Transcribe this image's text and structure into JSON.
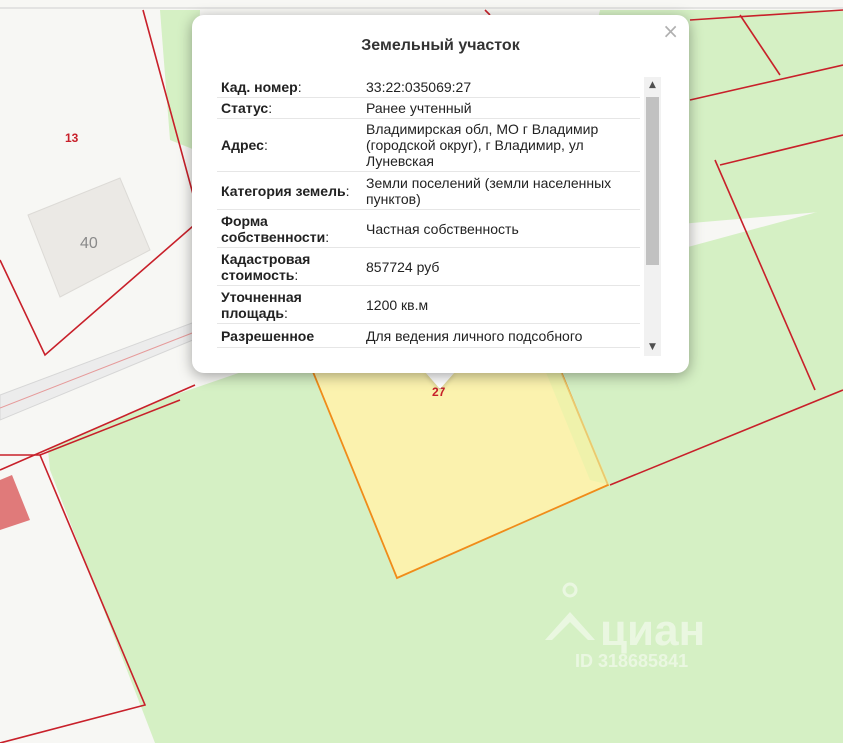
{
  "map": {
    "labels": {
      "parcel_13": "13",
      "building_40": "40",
      "parcel_27": "27"
    },
    "watermark": {
      "brand": "циан",
      "id_text": "ID 318685841"
    },
    "colors": {
      "land_green": "#d5f0c4",
      "boundary_red": "#c8202a",
      "selected_fill": "#fbf2ae",
      "selected_border": "#f08c19"
    }
  },
  "popup": {
    "title": "Земельный участок",
    "close_symbol": "×",
    "rows": [
      {
        "label": "Кад. номер",
        "colon": ":",
        "value": "33:22:035069:27"
      },
      {
        "label": "Статус",
        "colon": ":",
        "value": "Ранее учтенный"
      },
      {
        "label": "Адрес",
        "colon": ":",
        "value": "Владимирская обл, МО г Владимир (городской округ), г Владимир, ул Луневская"
      },
      {
        "label": "Категория земель",
        "colon": ":",
        "value": "Земли поселений (земли населенных пунктов)"
      },
      {
        "label": "Форма собственности",
        "colon": ":",
        "value": "Частная собственность"
      },
      {
        "label": "Кадастровая стоимость",
        "colon": ":",
        "value": "857724 руб"
      },
      {
        "label": "Уточненная площадь",
        "colon": ":",
        "value": "1200 кв.м"
      },
      {
        "label": "Разрешенное",
        "colon": "",
        "value": "Для ведения личного подсобного"
      }
    ],
    "scrollbar": {
      "up_icon": "▲",
      "down_icon": "▼"
    }
  }
}
